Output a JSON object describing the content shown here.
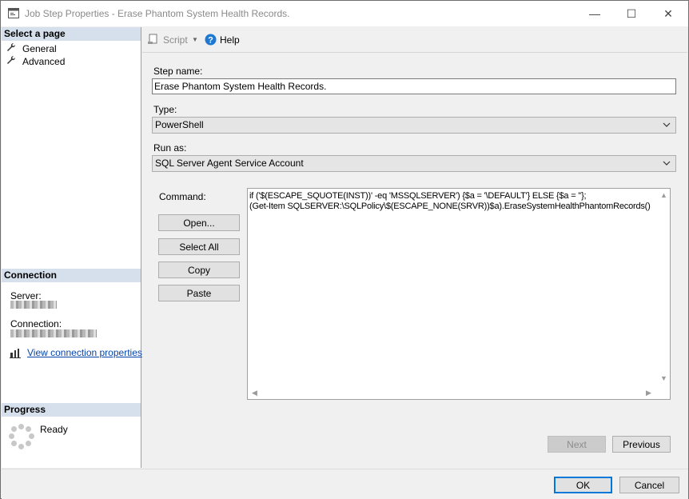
{
  "window": {
    "title": "Job Step Properties - Erase Phantom System Health Records.",
    "controls": {
      "minimize": "—",
      "maximize": "☐",
      "close": "✕"
    }
  },
  "sidebar": {
    "select_page_header": "Select a page",
    "pages": [
      {
        "label": "General",
        "icon": "wrench-icon"
      },
      {
        "label": "Advanced",
        "icon": "wrench-icon"
      }
    ],
    "connection_header": "Connection",
    "server_label": "Server:",
    "connection_label": "Connection:",
    "view_connection_link": "View connection properties",
    "progress_header": "Progress",
    "progress_status": "Ready"
  },
  "toolbar": {
    "script_label": "Script",
    "help_label": "Help"
  },
  "form": {
    "step_name_label": "Step name:",
    "step_name_value": "Erase Phantom System Health Records.",
    "type_label": "Type:",
    "type_value": "PowerShell",
    "run_as_label": "Run as:",
    "run_as_value": "SQL Server Agent Service Account",
    "command_label": "Command:",
    "command_lines": [
      "if ('$(ESCAPE_SQUOTE(INST))' -eq 'MSSQLSERVER') {$a = '\\DEFAULT'} ELSE {$a = ''};",
      "(Get-Item SQLSERVER:\\SQLPolicy\\$(ESCAPE_NONE(SRVR))$a).EraseSystemHealthPhantomRecords()"
    ],
    "buttons": {
      "open": "Open...",
      "select_all": "Select All",
      "copy": "Copy",
      "paste": "Paste"
    }
  },
  "navigation": {
    "next": "Next",
    "previous": "Previous"
  },
  "footer": {
    "ok": "OK",
    "cancel": "Cancel"
  },
  "colors": {
    "section_header_bg": "#d6e0ec",
    "primary_border": "#0078d7",
    "link": "#0645ad"
  }
}
